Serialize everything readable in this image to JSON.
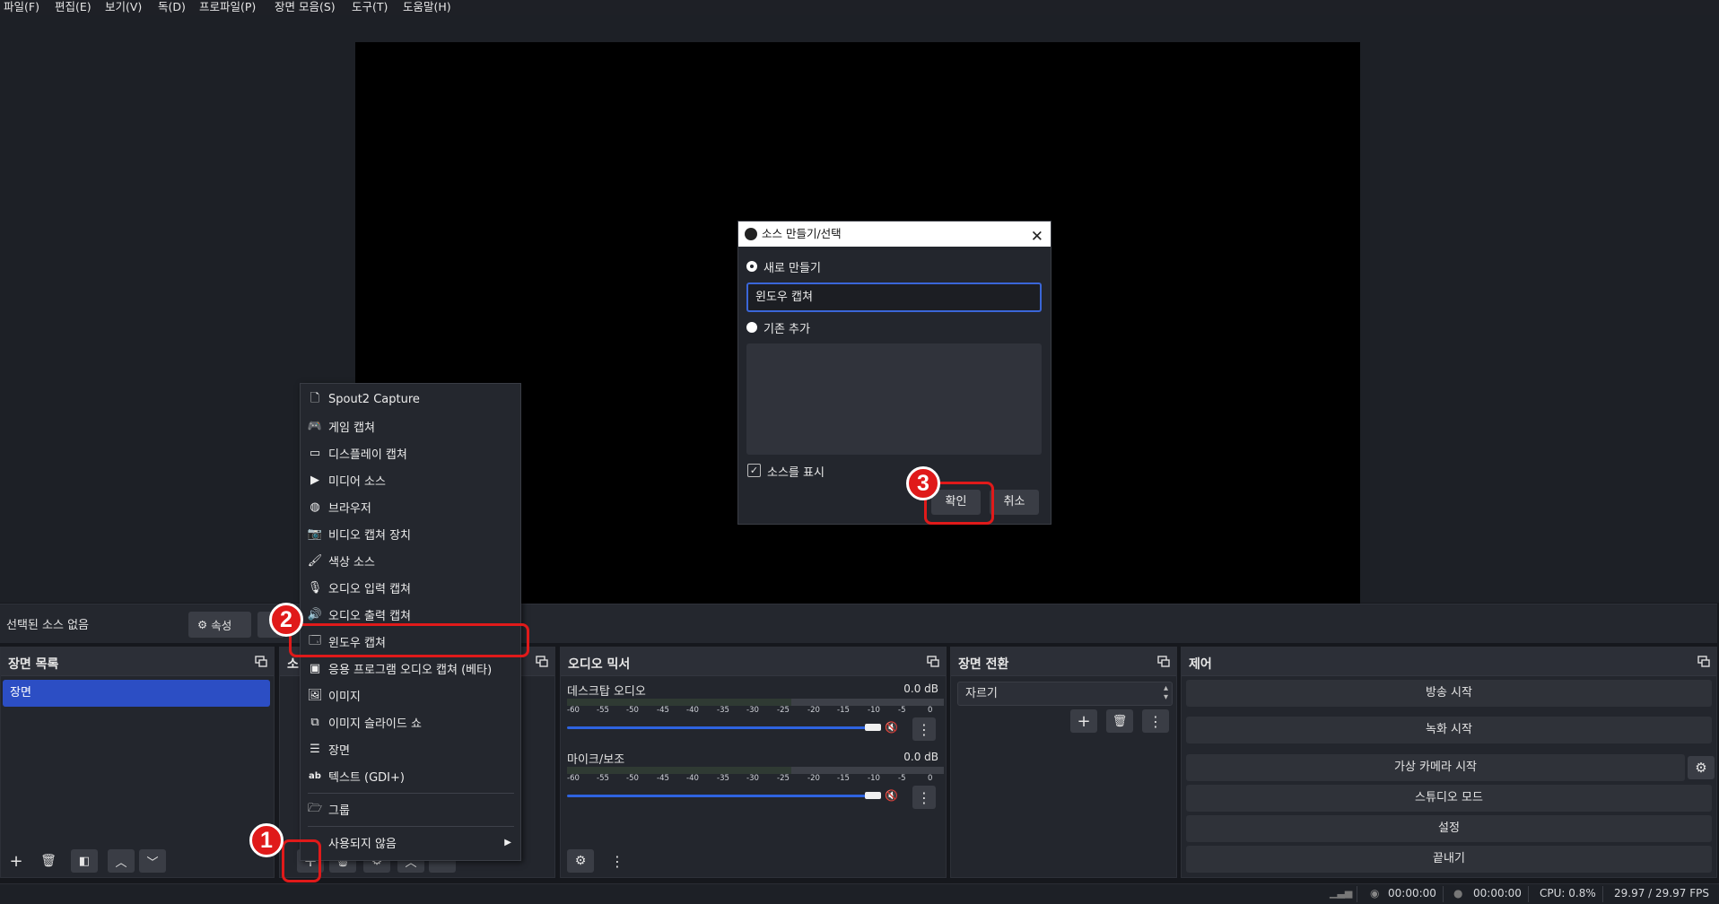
{
  "menubar": {
    "items": [
      "파일(F)",
      "편집(E)",
      "보기(V)",
      "독(D)",
      "프로파일(P)",
      "장면 모음(S)",
      "도구(T)",
      "도움말(H)"
    ]
  },
  "source_toolbar": {
    "no_source_text": "선택된 소스 없음",
    "properties_label": "속성"
  },
  "docks": {
    "scenes": {
      "title": "장면 목록",
      "items": [
        "장면"
      ]
    },
    "sources": {
      "title": "소"
    },
    "audio_mixer": {
      "title": "오디오 믹서",
      "channels": [
        {
          "name": "데스크탑 오디오",
          "db": "0.0 dB"
        },
        {
          "name": "마이크/보조",
          "db": "0.0 dB"
        }
      ],
      "ticks": [
        "-60",
        "-55",
        "-50",
        "-45",
        "-40",
        "-35",
        "-30",
        "-25",
        "-20",
        "-15",
        "-10",
        "-5",
        "0"
      ]
    },
    "transitions": {
      "title": "장면 전환",
      "selected": "자르기"
    },
    "controls": {
      "title": "제어",
      "buttons": [
        "방송 시작",
        "녹화 시작",
        "가상 카메라 시작",
        "스튜디오 모드",
        "설정",
        "끝내기"
      ]
    }
  },
  "context_menu": {
    "items": [
      {
        "label": "Spout2 Capture",
        "icon": "file-icon"
      },
      {
        "label": "게임 캡쳐",
        "icon": "gamepad-icon"
      },
      {
        "label": "디스플레이 캡쳐",
        "icon": "monitor-icon"
      },
      {
        "label": "미디어 소스",
        "icon": "play-icon"
      },
      {
        "label": "브라우저",
        "icon": "globe-icon"
      },
      {
        "label": "비디오 캡쳐 장치",
        "icon": "camera-icon"
      },
      {
        "label": "색상 소스",
        "icon": "brush-icon"
      },
      {
        "label": "오디오 입력 캡쳐",
        "icon": "microphone-icon"
      },
      {
        "label": "오디오 출력 캡쳐",
        "icon": "speaker-icon"
      },
      {
        "label": "윈도우 캡쳐",
        "icon": "window-icon"
      },
      {
        "label": "응용 프로그램 오디오 캡쳐 (베타)",
        "icon": "app-audio-icon"
      },
      {
        "label": "이미지",
        "icon": "image-icon"
      },
      {
        "label": "이미지 슬라이드 쇼",
        "icon": "slideshow-icon"
      },
      {
        "label": "장면",
        "icon": "list-icon"
      },
      {
        "label": "텍스트 (GDI+)",
        "icon": "text-icon"
      },
      {
        "label": "그룹",
        "icon": "folder-icon"
      },
      {
        "label": "사용되지 않음",
        "icon": ""
      }
    ]
  },
  "dialog": {
    "title": "소스 만들기/선택",
    "create_new_label": "새로 만들기",
    "name_value": "윈도우 캡쳐",
    "add_existing_label": "기존 추가",
    "make_visible_label": "소스를 표시",
    "ok_label": "확인",
    "cancel_label": "취소"
  },
  "annotations": [
    "1",
    "2",
    "3"
  ],
  "statusbar": {
    "time1": "00:00:00",
    "time2": "00:00:00",
    "cpu": "CPU: 0.8%",
    "fps": "29.97 / 29.97 FPS"
  },
  "colors": {
    "accent": "#2c4ec4",
    "highlight": "#e01a1a",
    "panel": "#23262d"
  }
}
